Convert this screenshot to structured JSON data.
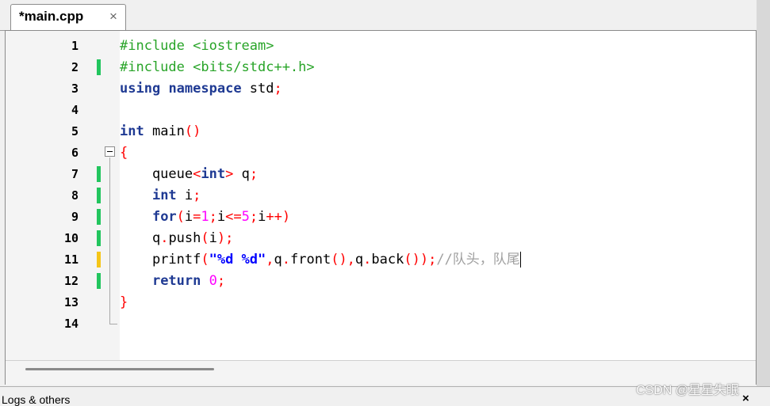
{
  "tab": {
    "title": "*main.cpp",
    "close": "×"
  },
  "colors": {
    "line_modified_saved": "#22c55e",
    "line_modified_unsaved": "#f5c518",
    "keyword": "#1f3a93",
    "string": "#0000ff",
    "preprocessor": "#28a428",
    "symbol": "#ff0000",
    "number": "#ff00ff",
    "comment": "#a0a0a0"
  },
  "editor": {
    "lines": [
      {
        "n": "1",
        "mark": "",
        "tokens": [
          {
            "t": "#include <iostream>",
            "c": "#28a428"
          }
        ]
      },
      {
        "n": "2",
        "mark": "#22c55e",
        "tokens": [
          {
            "t": "#include <bits/stdc++.h>",
            "c": "#28a428"
          }
        ]
      },
      {
        "n": "3",
        "mark": "",
        "tokens": [
          {
            "t": "using",
            "c": "#1f3a93",
            "b": true
          },
          {
            "t": " "
          },
          {
            "t": "namespace",
            "c": "#1f3a93",
            "b": true
          },
          {
            "t": " std"
          },
          {
            "t": ";",
            "c": "#ff0000"
          }
        ]
      },
      {
        "n": "4",
        "mark": "",
        "tokens": []
      },
      {
        "n": "5",
        "mark": "",
        "tokens": [
          {
            "t": "int",
            "c": "#1f3a93",
            "b": true
          },
          {
            "t": " main"
          },
          {
            "t": "()",
            "c": "#ff0000"
          }
        ]
      },
      {
        "n": "6",
        "mark": "",
        "tokens": [
          {
            "t": "{",
            "c": "#ff0000"
          }
        ]
      },
      {
        "n": "7",
        "mark": "#22c55e",
        "tokens": [
          {
            "t": "    queue"
          },
          {
            "t": "<",
            "c": "#ff0000"
          },
          {
            "t": "int",
            "c": "#1f3a93",
            "b": true
          },
          {
            "t": ">",
            "c": "#ff0000"
          },
          {
            "t": " q"
          },
          {
            "t": ";",
            "c": "#ff0000"
          }
        ]
      },
      {
        "n": "8",
        "mark": "#22c55e",
        "tokens": [
          {
            "t": "    "
          },
          {
            "t": "int",
            "c": "#1f3a93",
            "b": true
          },
          {
            "t": " i"
          },
          {
            "t": ";",
            "c": "#ff0000"
          }
        ]
      },
      {
        "n": "9",
        "mark": "#22c55e",
        "tokens": [
          {
            "t": "    "
          },
          {
            "t": "for",
            "c": "#1f3a93",
            "b": true
          },
          {
            "t": "(",
            "c": "#ff0000"
          },
          {
            "t": "i"
          },
          {
            "t": "=",
            "c": "#ff0000"
          },
          {
            "t": "1",
            "c": "#ff00ff"
          },
          {
            "t": ";",
            "c": "#ff0000"
          },
          {
            "t": "i"
          },
          {
            "t": "<=",
            "c": "#ff0000"
          },
          {
            "t": "5",
            "c": "#ff00ff"
          },
          {
            "t": ";",
            "c": "#ff0000"
          },
          {
            "t": "i"
          },
          {
            "t": "++)",
            "c": "#ff0000"
          }
        ]
      },
      {
        "n": "10",
        "mark": "#22c55e",
        "tokens": [
          {
            "t": "    q"
          },
          {
            "t": ".",
            "c": "#ff0000"
          },
          {
            "t": "push"
          },
          {
            "t": "(",
            "c": "#ff0000"
          },
          {
            "t": "i"
          },
          {
            "t": ");",
            "c": "#ff0000"
          }
        ]
      },
      {
        "n": "11",
        "mark": "#f5c518",
        "tokens": [
          {
            "t": "    printf"
          },
          {
            "t": "(",
            "c": "#ff0000"
          },
          {
            "t": "\"%d %d\"",
            "c": "#0000ff",
            "b": true
          },
          {
            "t": ",",
            "c": "#ff0000"
          },
          {
            "t": "q"
          },
          {
            "t": ".",
            "c": "#ff0000"
          },
          {
            "t": "front"
          },
          {
            "t": "(),",
            "c": "#ff0000"
          },
          {
            "t": "q"
          },
          {
            "t": ".",
            "c": "#ff0000"
          },
          {
            "t": "back"
          },
          {
            "t": "());",
            "c": "#ff0000"
          },
          {
            "t": "//队头，队尾",
            "c": "#a0a0a0"
          }
        ],
        "cursor": true
      },
      {
        "n": "12",
        "mark": "#22c55e",
        "tokens": [
          {
            "t": "    "
          },
          {
            "t": "return",
            "c": "#1f3a93",
            "b": true
          },
          {
            "t": " "
          },
          {
            "t": "0",
            "c": "#ff00ff"
          },
          {
            "t": ";",
            "c": "#ff0000"
          }
        ]
      },
      {
        "n": "13",
        "mark": "",
        "tokens": [
          {
            "t": "}",
            "c": "#ff0000"
          }
        ]
      },
      {
        "n": "14",
        "mark": "",
        "tokens": []
      }
    ]
  },
  "bottom_panel": {
    "label": "Logs & others",
    "close": "×"
  },
  "watermark": "CSDN @星星失眠"
}
